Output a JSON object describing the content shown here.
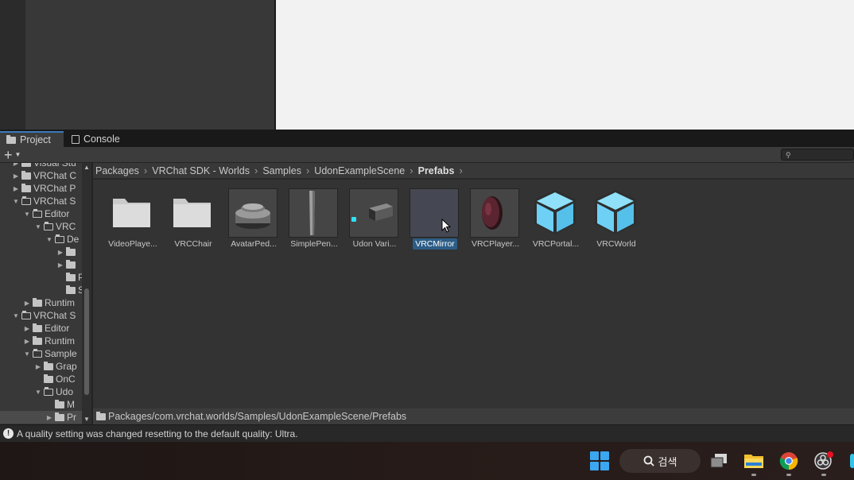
{
  "tabs": [
    {
      "label": "Project",
      "icon": "folder-icon",
      "active": true
    },
    {
      "label": "Console",
      "icon": "console-icon",
      "active": false
    }
  ],
  "toolbar": {
    "add_label": "+",
    "search_placeholder": ""
  },
  "tree": [
    {
      "label": "Visual Stu",
      "depth": 1,
      "expanded": false
    },
    {
      "label": "VRChat C",
      "depth": 1,
      "expanded": false
    },
    {
      "label": "VRChat P",
      "depth": 1,
      "expanded": false
    },
    {
      "label": "VRChat S",
      "depth": 1,
      "expanded": true
    },
    {
      "label": "Editor",
      "depth": 2,
      "expanded": true
    },
    {
      "label": "VRC",
      "depth": 3,
      "expanded": true
    },
    {
      "label": "De",
      "depth": 4,
      "expanded": true
    },
    {
      "label": "",
      "depth": 5,
      "expanded": false
    },
    {
      "label": "",
      "depth": 5,
      "expanded": false
    },
    {
      "label": "Pl",
      "depth": 5,
      "leaf": true
    },
    {
      "label": "Sa",
      "depth": 5,
      "leaf": true
    },
    {
      "label": "Runtim",
      "depth": 2,
      "expanded": false
    },
    {
      "label": "VRChat S",
      "depth": 1,
      "expanded": true
    },
    {
      "label": "Editor",
      "depth": 2,
      "expanded": false
    },
    {
      "label": "Runtim",
      "depth": 2,
      "expanded": false
    },
    {
      "label": "Sample",
      "depth": 2,
      "expanded": true
    },
    {
      "label": "Grap",
      "depth": 3,
      "expanded": false
    },
    {
      "label": "OnC",
      "depth": 3,
      "leaf": true
    },
    {
      "label": "Udo",
      "depth": 3,
      "expanded": true
    },
    {
      "label": "M",
      "depth": 4,
      "leaf": true
    },
    {
      "label": "Pr",
      "depth": 4,
      "expanded": false,
      "selected": true
    }
  ],
  "breadcrumb": [
    "Packages",
    "VRChat SDK - Worlds",
    "Samples",
    "UdonExampleScene",
    "Prefabs"
  ],
  "assets": [
    {
      "label": "VideoPlaye...",
      "kind": "folder",
      "icon": "folder-icon"
    },
    {
      "label": "VRCChair",
      "kind": "folder",
      "icon": "folder-icon"
    },
    {
      "label": "AvatarPed...",
      "kind": "preview",
      "icon": "pedestal-preview-icon"
    },
    {
      "label": "SimplePen...",
      "kind": "preview",
      "icon": "pen-preview-icon"
    },
    {
      "label": "Udon Vari...",
      "kind": "preview",
      "icon": "cube-preview-icon"
    },
    {
      "label": "VRCMirror",
      "kind": "preview",
      "icon": "mirror-preview-icon",
      "selected": true
    },
    {
      "label": "VRCPlayer...",
      "kind": "preview",
      "icon": "disc-preview-icon"
    },
    {
      "label": "VRCPortal...",
      "kind": "prefab",
      "icon": "prefab-cube-icon"
    },
    {
      "label": "VRCWorld",
      "kind": "prefab",
      "icon": "prefab-cube-icon"
    }
  ],
  "path_bar": "Packages/com.vrchat.worlds/Samples/UdonExampleScene/Prefabs",
  "status": {
    "message": "A quality setting was changed resetting to the default quality: Ultra."
  },
  "taskbar": {
    "search_label": "검색"
  },
  "colors": {
    "accent": "#3a79bb",
    "selection": "#2c5d87",
    "prefab_cube": "#6fd0f5",
    "windows_blue": "#3aa7f0"
  }
}
